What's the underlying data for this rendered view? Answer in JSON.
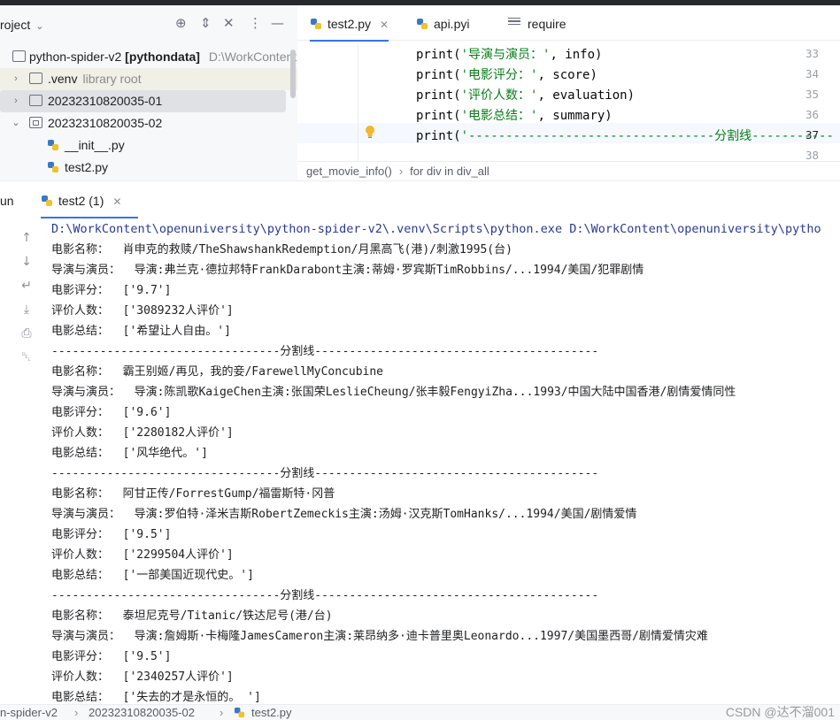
{
  "project": {
    "title": "roject",
    "tree": [
      {
        "label": "python-spider-v2",
        "bold_suffix": "[pythondata]",
        "muted": "D:\\WorkContent",
        "kind": "folder"
      },
      {
        "label": ".venv",
        "muted": "library root",
        "kind": "folder"
      },
      {
        "label": "20232310820035-01",
        "kind": "folder"
      },
      {
        "label": "20232310820035-02",
        "kind": "package"
      },
      {
        "label": "__init__.py",
        "kind": "py"
      },
      {
        "label": "test2.py",
        "kind": "py"
      }
    ]
  },
  "editor": {
    "tabs": [
      {
        "label": "test2.py",
        "active": true,
        "icon": "python-icon"
      },
      {
        "label": "api.pyi",
        "active": false,
        "icon": "python-icon"
      },
      {
        "label": "require",
        "active": false,
        "icon": "menu-icon"
      }
    ],
    "lines": [
      {
        "num": "33",
        "fn": "print(",
        "str": "'导演与演员：'",
        "rest": ", info)"
      },
      {
        "num": "34",
        "fn": "print(",
        "str": "'电影评分：'",
        "rest": ", score)"
      },
      {
        "num": "35",
        "fn": "print(",
        "str": "'评价人数：'",
        "rest": ", evaluation)"
      },
      {
        "num": "36",
        "fn": "print(",
        "str": "'电影总结：'",
        "rest": ", summary)"
      },
      {
        "num": "37",
        "fn": "print(",
        "str": "'---------------------------------分割线-----------",
        "rest": ""
      },
      {
        "num": "38",
        "fn": "",
        "str": "",
        "rest": ""
      }
    ],
    "breadcrumb": [
      "get_movie_info()",
      "for div in div_all"
    ]
  },
  "run": {
    "title": "un",
    "tab_label": "test2 (1)",
    "path_line": "D:\\WorkContent\\openuniversity\\python-spider-v2\\.venv\\Scripts\\python.exe D:\\WorkContent\\openuniversity\\pytho",
    "output": [
      "电影名称：  肖申克的救赎/TheShawshankRedemption/月黑高飞(港)/刺激1995(台)",
      "导演与演员：  导演:弗兰克·德拉邦特FrankDarabont主演:蒂姆·罗宾斯TimRobbins/...1994/美国/犯罪剧情",
      "电影评分：  ['9.7']",
      "评价人数：  ['3089232人评价']",
      "电影总结：  ['希望让人自由。']",
      "---------------------------------分割线-----------------------------------------",
      "电影名称：  霸王别姬/再见，我的妾/FarewellMyConcubine",
      "导演与演员：  导演:陈凯歌KaigeChen主演:张国荣LeslieCheung/张丰毅FengyiZha...1993/中国大陆中国香港/剧情爱情同性",
      "电影评分：  ['9.6']",
      "评价人数：  ['2280182人评价']",
      "电影总结：  ['风华绝代。']",
      "---------------------------------分割线-----------------------------------------",
      "电影名称：  阿甘正传/ForrestGump/福雷斯特·冈普",
      "导演与演员：  导演:罗伯特·泽米吉斯RobertZemeckis主演:汤姆·汉克斯TomHanks/...1994/美国/剧情爱情",
      "电影评分：  ['9.5']",
      "评价人数：  ['2299504人评价']",
      "电影总结：  ['一部美国近现代史。']",
      "---------------------------------分割线-----------------------------------------",
      "电影名称：  泰坦尼克号/Titanic/铁达尼号(港/台)",
      "导演与演员：  导演:詹姆斯·卡梅隆JamesCameron主演:莱昂纳多·迪卡普里奥Leonardo...1997/美国墨西哥/剧情爱情灾难",
      "电影评分：  ['9.5']",
      "评价人数：  ['2340257人评价']",
      "电影总结：  ['失去的才是永恒的。 ']"
    ]
  },
  "statusbar": {
    "crumbs": [
      "n-spider-v2",
      "20232310820035-02",
      "test2.py"
    ],
    "watermark": "CSDN @达不溜001"
  },
  "colors": {
    "accent": "#3574f0",
    "string": "#067d17",
    "path": "#2a3a8f"
  }
}
